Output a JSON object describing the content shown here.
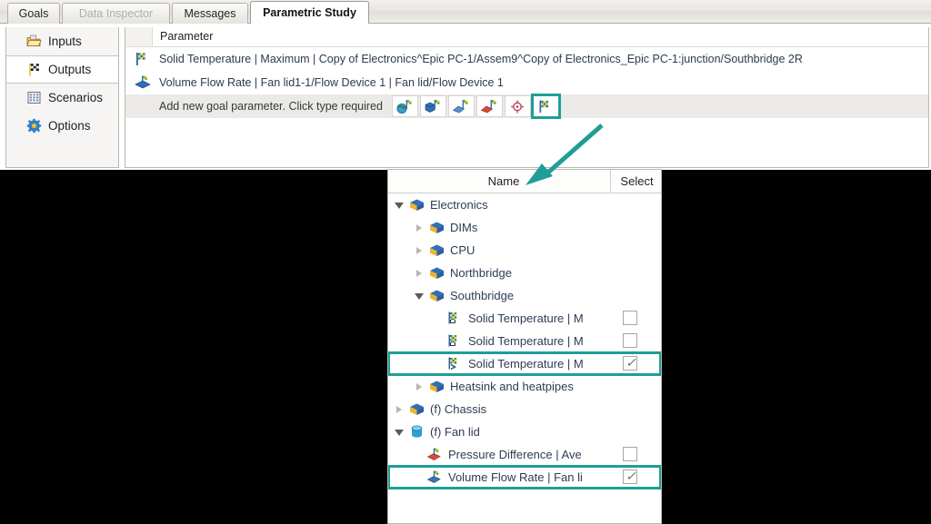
{
  "window": {
    "title": "Parametric Study"
  },
  "tabs": [
    {
      "label": "Goals",
      "state": "normal"
    },
    {
      "label": "Data Inspector",
      "state": "disabled"
    },
    {
      "label": "Messages",
      "state": "normal"
    },
    {
      "label": "Parametric Study",
      "state": "active"
    }
  ],
  "sidebar": {
    "items": [
      {
        "label": "Inputs",
        "icon": "folder-open-icon",
        "selected": false
      },
      {
        "label": "Outputs",
        "icon": "checkered-flag-icon",
        "selected": true
      },
      {
        "label": "Scenarios",
        "icon": "grid-table-icon",
        "selected": false
      },
      {
        "label": "Options",
        "icon": "gear-icon",
        "selected": false
      }
    ]
  },
  "grid": {
    "column_header": "Parameter",
    "rows": [
      {
        "icon": "goal-flag-icon",
        "text": "Solid Temperature | Maximum | Copy of Electronics^Epic PC-1/Assem9^Copy of Electronics_Epic PC-1:junction/Southbridge 2R"
      },
      {
        "icon": "flow-goal-icon",
        "text": "Volume Flow Rate | Fan lid1-1/Flow Device 1 | Fan lid/Flow Device 1"
      }
    ],
    "add_row": {
      "text": "Add new goal parameter. Click type required",
      "buttons": [
        {
          "name": "global-goal-button",
          "icon": "globe-goal-icon",
          "highlighted": false
        },
        {
          "name": "volume-goal-button",
          "icon": "volume-goal-icon",
          "highlighted": false
        },
        {
          "name": "surface-goal-button",
          "icon": "surface-goal-icon",
          "highlighted": false
        },
        {
          "name": "point-goal-button",
          "icon": "point-goal-icon",
          "highlighted": false
        },
        {
          "name": "equation-goal-button",
          "icon": "crosshair-goal-icon",
          "highlighted": false
        },
        {
          "name": "existing-goal-button",
          "icon": "checkered-flag-goal-icon",
          "highlighted": true
        }
      ]
    }
  },
  "tree": {
    "columns": {
      "name": "Name",
      "select": "Select"
    },
    "rows": [
      {
        "label": "Electronics",
        "level": 0,
        "expander": "expanded",
        "icon": "assembly-box-icon",
        "checkbox": null,
        "boxed": false
      },
      {
        "label": "DIMs",
        "level": 1,
        "expander": "collapsed",
        "icon": "assembly-box-icon",
        "checkbox": null,
        "boxed": false
      },
      {
        "label": "CPU",
        "level": 1,
        "expander": "collapsed",
        "icon": "assembly-box-icon",
        "checkbox": null,
        "boxed": false
      },
      {
        "label": "Northbridge",
        "level": 1,
        "expander": "collapsed",
        "icon": "assembly-box-icon",
        "checkbox": null,
        "boxed": false
      },
      {
        "label": "Southbridge",
        "level": 1,
        "expander": "expanded",
        "icon": "assembly-box-icon",
        "checkbox": null,
        "boxed": false
      },
      {
        "label": "Solid Temperature | M",
        "level": 2,
        "expander": "none",
        "icon": "goal-flag-house-icon",
        "checkbox": "unchecked",
        "boxed": false
      },
      {
        "label": "Solid Temperature | M",
        "level": 2,
        "expander": "none",
        "icon": "goal-flag-house-icon",
        "checkbox": "unchecked",
        "boxed": false
      },
      {
        "label": "Solid Temperature | M",
        "level": 2,
        "expander": "none",
        "icon": "goal-flag-arrow-icon",
        "checkbox": "checked",
        "boxed": true
      },
      {
        "label": "Heatsink and heatpipes",
        "level": 1,
        "expander": "collapsed",
        "icon": "assembly-box-icon",
        "checkbox": null,
        "boxed": false
      },
      {
        "label": "(f) Chassis",
        "level": 0,
        "expander": "collapsed",
        "icon": "assembly-box-icon",
        "checkbox": null,
        "boxed": false
      },
      {
        "label": "(f) Fan lid",
        "level": 0,
        "expander": "expanded",
        "icon": "cylinder-icon",
        "checkbox": null,
        "boxed": false
      },
      {
        "label": "Pressure Difference | Ave",
        "level": 1,
        "expander": "none",
        "icon": "flow-goal-red-icon",
        "checkbox": "unchecked",
        "boxed": false
      },
      {
        "label": "Volume Flow Rate | Fan li",
        "level": 1,
        "expander": "none",
        "icon": "flow-goal-blue-icon",
        "checkbox": "checked",
        "boxed": true
      }
    ]
  },
  "annotation": {
    "arrow_color": "#1f9e96",
    "highlight_color": "#1f9e96"
  }
}
